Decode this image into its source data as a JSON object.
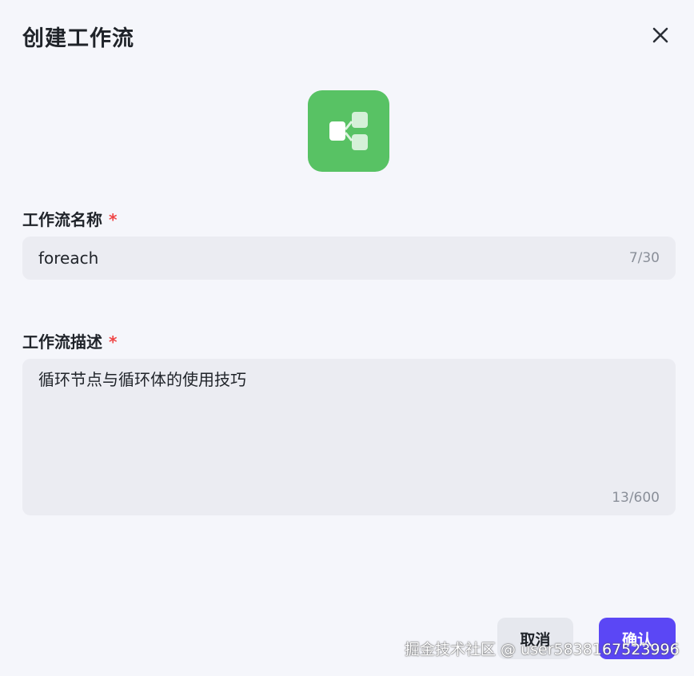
{
  "dialog": {
    "title": "创建工作流",
    "close_icon": "close-icon"
  },
  "app_icon": {
    "name": "workflow-icon",
    "color": "#58c264"
  },
  "name_field": {
    "label": "工作流名称",
    "required_mark": "*",
    "value": "foreach",
    "counter": "7/30"
  },
  "desc_field": {
    "label": "工作流描述",
    "required_mark": "*",
    "value": "循环节点与循环体的使用技巧",
    "counter": "13/600"
  },
  "actions": {
    "cancel_label": "取消",
    "confirm_label": "确认",
    "confirm_color": "#5b47f5"
  },
  "watermark": "掘金技术社区 @ user5838167523996"
}
